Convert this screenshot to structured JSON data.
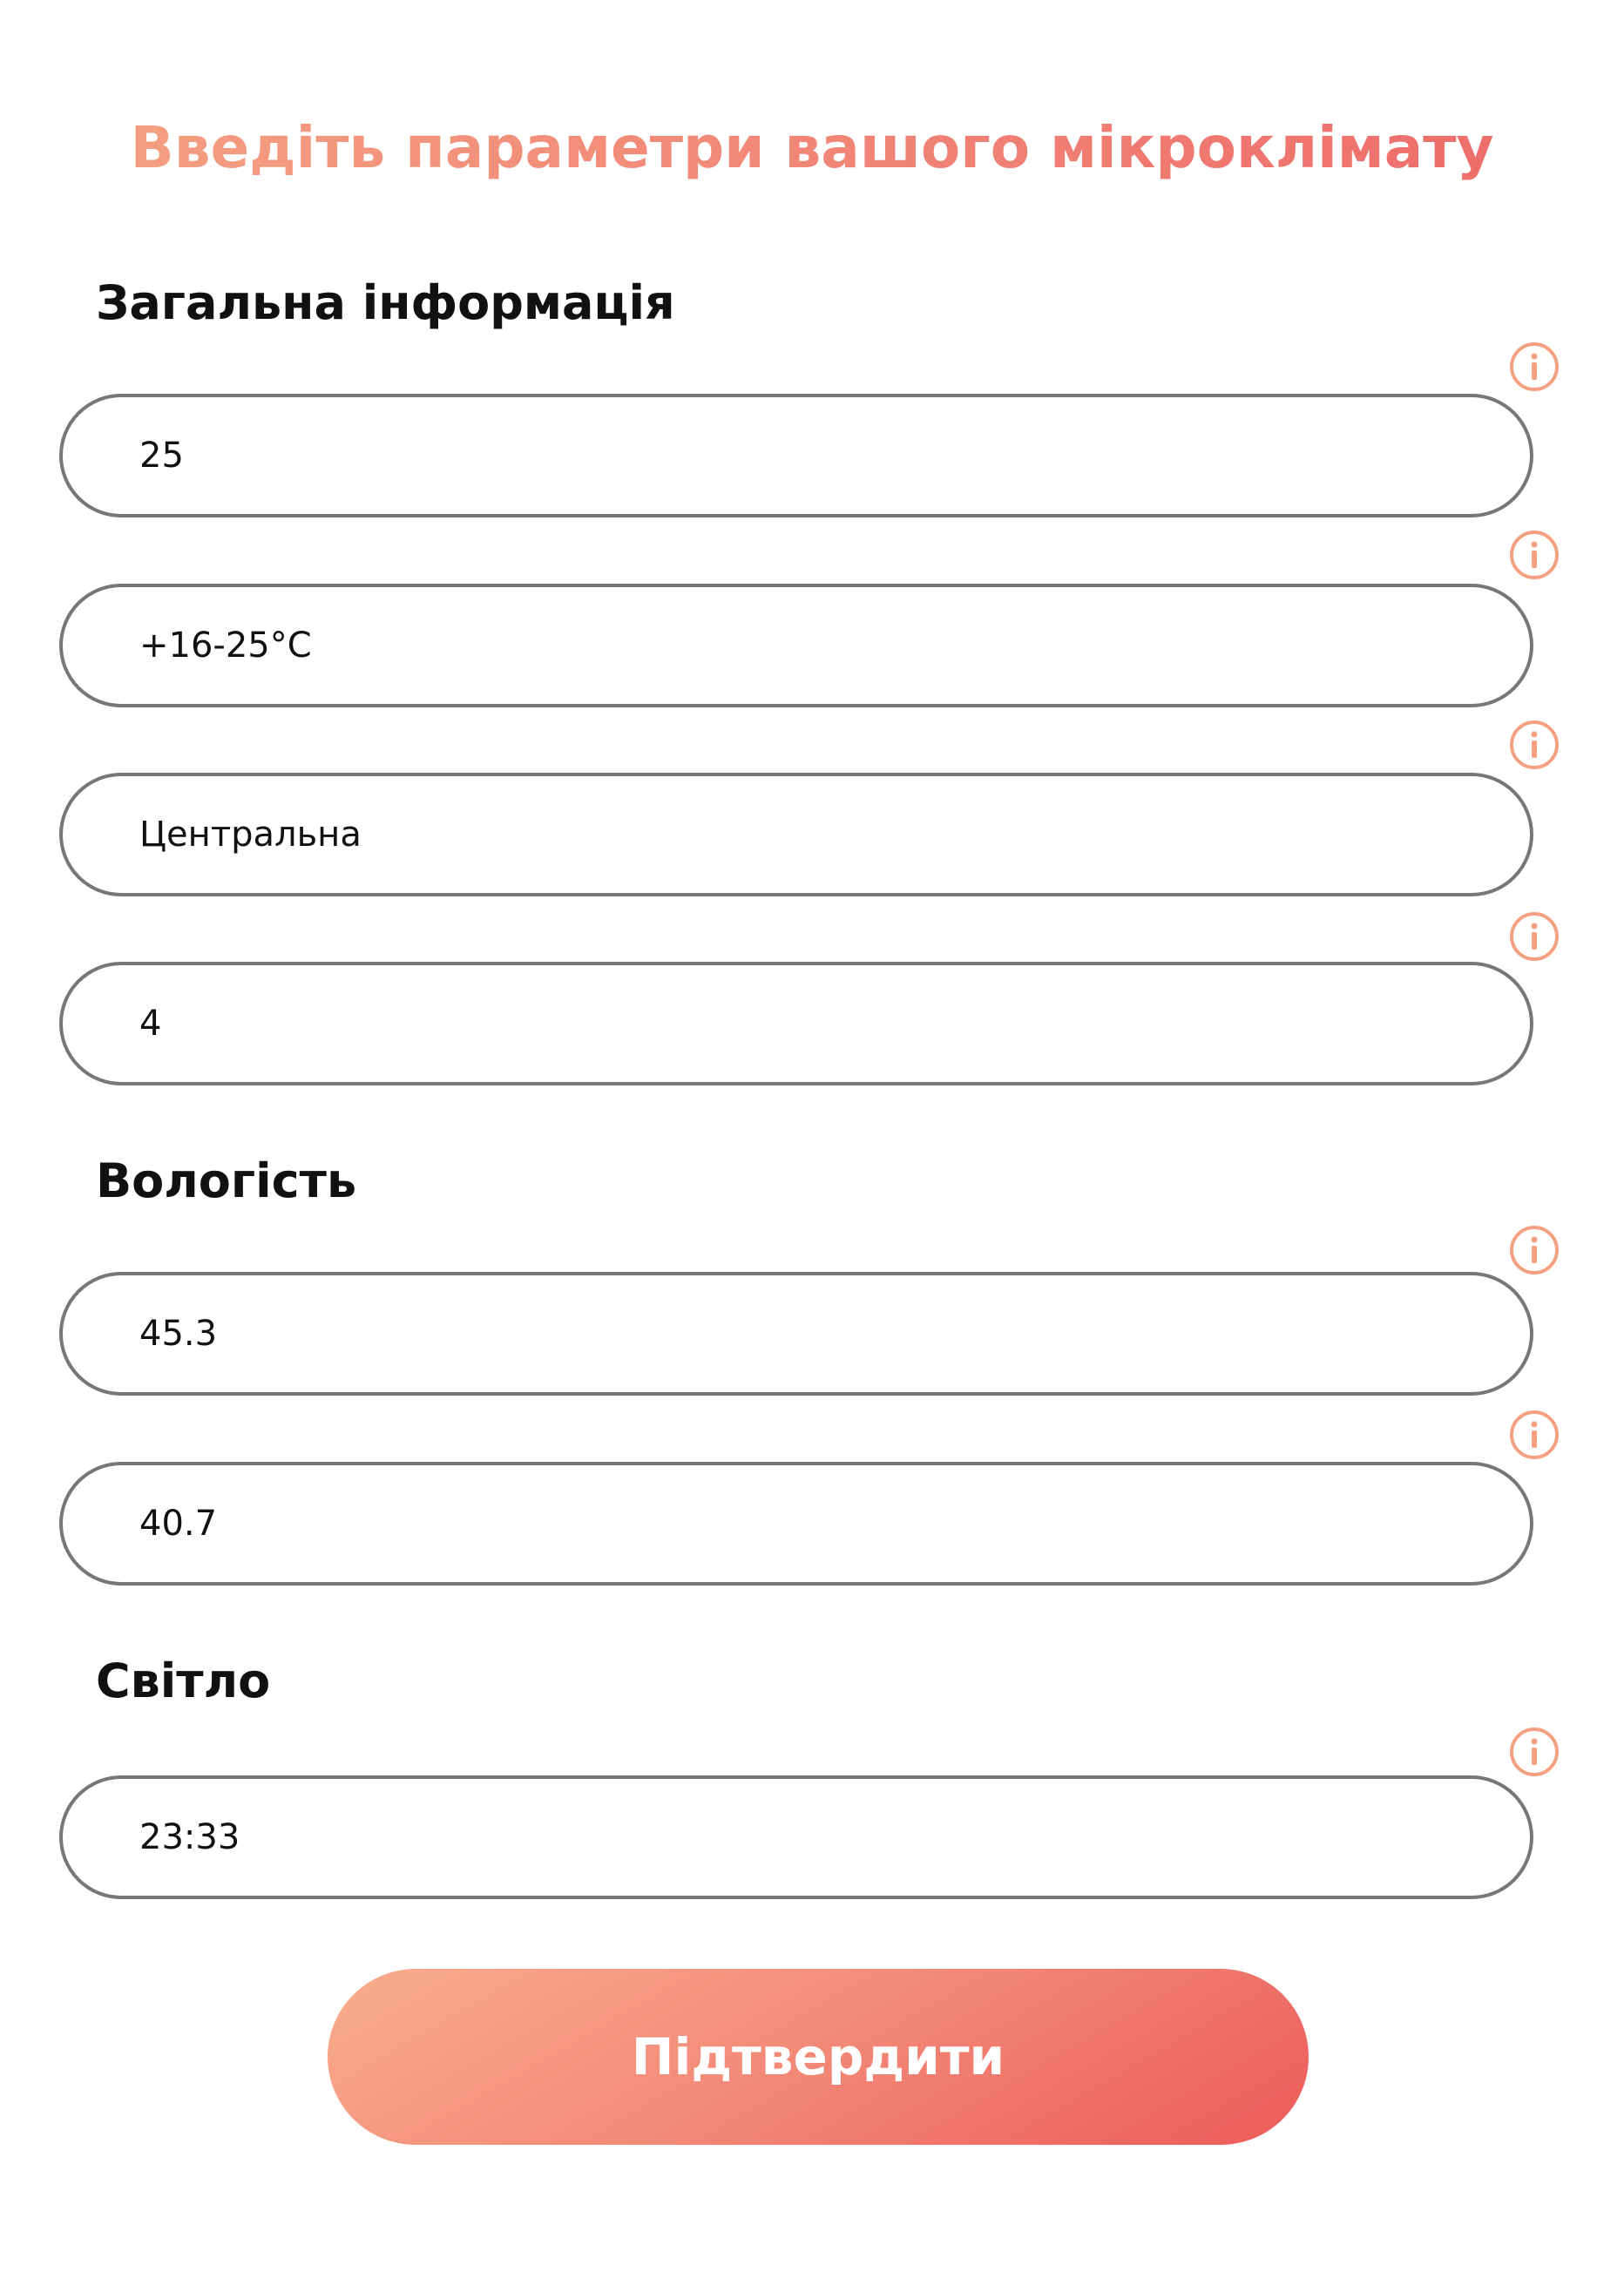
{
  "page": {
    "title": "Введіть параметри вашого мікроклімату"
  },
  "colors": {
    "accent_start": "#f4a182",
    "accent_end": "#ec5a5a",
    "icon": "#f4a182",
    "field_border": "#777777"
  },
  "sections": [
    {
      "title": "Загальна інформація"
    },
    {
      "title": "Вологість"
    },
    {
      "title": "Світло"
    }
  ],
  "fields": [
    {
      "value": "25",
      "icon": "info-icon"
    },
    {
      "value": "+16-25°C",
      "icon": "info-icon"
    },
    {
      "value": "Центральна",
      "icon": "info-icon"
    },
    {
      "value": "4",
      "icon": "info-icon"
    },
    {
      "value": "45.3",
      "icon": "info-icon"
    },
    {
      "value": "40.7",
      "icon": "info-icon"
    },
    {
      "value": "23:33",
      "icon": "info-icon"
    }
  ],
  "submit": {
    "label": "Підтвердити"
  }
}
